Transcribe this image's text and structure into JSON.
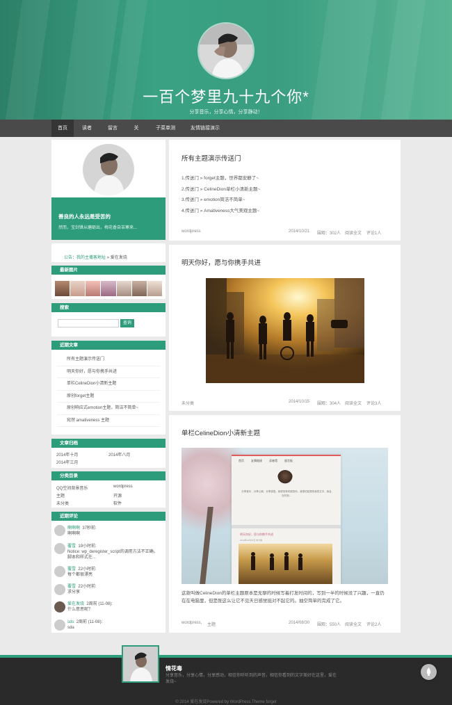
{
  "header": {
    "title": "一百个梦里九十九个你*",
    "subtitle": "分享音乐，分享心情，分享静动！"
  },
  "nav": {
    "items": [
      {
        "label": "首页"
      },
      {
        "label": "读者墙"
      },
      {
        "label": "留言板"
      },
      {
        "label": "关于"
      },
      {
        "label": "子菜单测试"
      },
      {
        "label": "友情链接演示"
      }
    ]
  },
  "sidebar": {
    "profile": {
      "name": "善良的人永远是受苦的",
      "bio": "然而，宝剑锋从磨砺出，梅花香自苦寒来..."
    },
    "notice": {
      "prefix": "公告：",
      "link": "我的主播客地址",
      "suffix": " » 爱在发烧"
    },
    "latest_images": {
      "title": "最新图片"
    },
    "search": {
      "title": "搜索",
      "placeholder": "",
      "button": "查询"
    },
    "recent_posts": {
      "title": "近期文章",
      "items": [
        "所有主题演示传送门",
        "明天你好，愿与你携手共进",
        "单栏CelineDion小清新主题",
        "原创forget主题",
        "原创响应式emotion主题，简洁不简单~",
        "宛然 amativeness 主题"
      ]
    },
    "archives": {
      "title": "文章归档",
      "items": [
        "2014年十月",
        "2014年八月",
        "2014年三月"
      ]
    },
    "categories": {
      "title": "分类目录",
      "items": [
        "QQ空间背景音乐",
        "wordpress",
        "主题",
        "开源",
        "未分类",
        "软件"
      ]
    },
    "comments": {
      "title": "近期评论",
      "items": [
        {
          "author": "啊啊啊",
          "time": "37秒前:",
          "text": "啊啊啊"
        },
        {
          "author": "覆雪",
          "time": "19小时前:",
          "text": "Notice: wp_deregister_script的调用方法不正确。脚本和样式在..."
        },
        {
          "author": "覆雪",
          "time": "22小时前:",
          "text": "每个都很漂亮"
        },
        {
          "author": "覆雪",
          "time": "22小时前:",
          "text": "求分享"
        },
        {
          "author": "爱在发烧",
          "time": "2周前 (11-08):",
          "text": "什么意思呢？"
        },
        {
          "author": "sds",
          "time": "2周前 (11-08):",
          "text": "sda"
        }
      ]
    }
  },
  "posts": [
    {
      "title": "所有主题演示传送门",
      "links": [
        "1.传送门 » forget主题，世界都安静了~",
        "2.传送门 » CelineDion单栏小清新主题~",
        "3.传送门 » emotion简洁不简单~",
        "4.传送门 » Amativeness大气美观主题~"
      ],
      "category": "wordpress",
      "date": "2014/10/21",
      "views": "围观：302人",
      "read_more": "阅读全文",
      "comments": "评论1人"
    },
    {
      "title": "明天你好，愿与你携手共进",
      "category": "未分类",
      "date": "2014/10/15",
      "views": "围观：304人",
      "read_more": "阅读全文",
      "comments": "评论3人"
    },
    {
      "title": "单栏CelineDion小清新主题",
      "excerpt": "这款叫做CelineDion的单栏主题原本是无聊的时候写着打发时间的，写到一半的时候没了兴趣，一直仍在在电脑里，但是既这么让它不见天日感觉挺对不起它的。抽空简单的完成了它。",
      "preview": {
        "nav": [
          "首页",
          "友情链接",
          "读者墙",
          "留言板"
        ],
        "text": "分享音乐，分享心情，分享感悟。我很怕有时候的你，我很怕若是的我的文字，我会在时刻...",
        "post_title": "明天你好，愿与你携手共进",
        "post_meta": "2014年10月15日   未分类"
      },
      "category": "wordpress,",
      "category2": "主题",
      "date": "2014/08/30",
      "views": "围观：550人",
      "read_more": "阅读全文",
      "comments": "评论2人"
    }
  ],
  "footer": {
    "name": "情花毒",
    "bio": "分享音乐，分享心情，分享感动，相信你听听到的声音，相信你看到的文字美好在这里，爱在发烧~",
    "copyright": "© 2014 爱在发烧Powered by WordPress.Theme forget"
  },
  "colors": {
    "accent": "#2d9c7a",
    "nav": "#4a4a4a",
    "footer": "#2a2a2a"
  }
}
